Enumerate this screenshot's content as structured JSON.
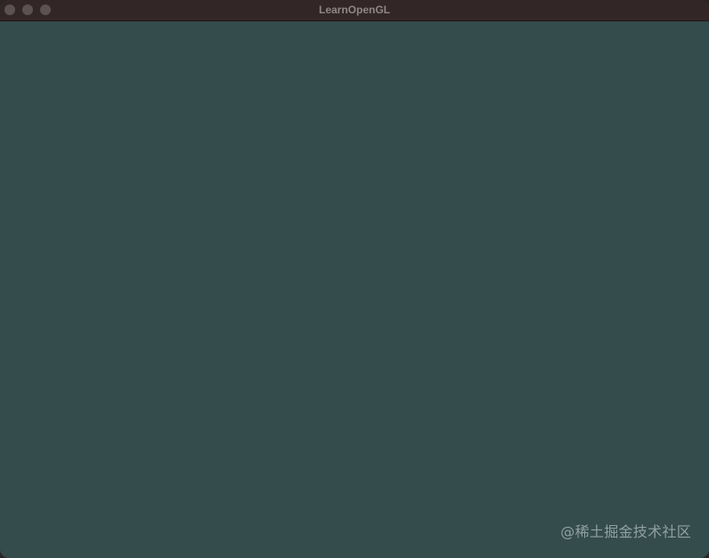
{
  "window": {
    "title": "LearnOpenGL",
    "background_color": "#334c4c"
  },
  "titlebar": {
    "buttons": [
      {
        "name": "close",
        "icon": "circle-icon"
      },
      {
        "name": "minimize",
        "icon": "circle-icon"
      },
      {
        "name": "maximize",
        "icon": "circle-icon"
      }
    ]
  },
  "watermark": {
    "text": "@稀土掘金技术社区"
  }
}
